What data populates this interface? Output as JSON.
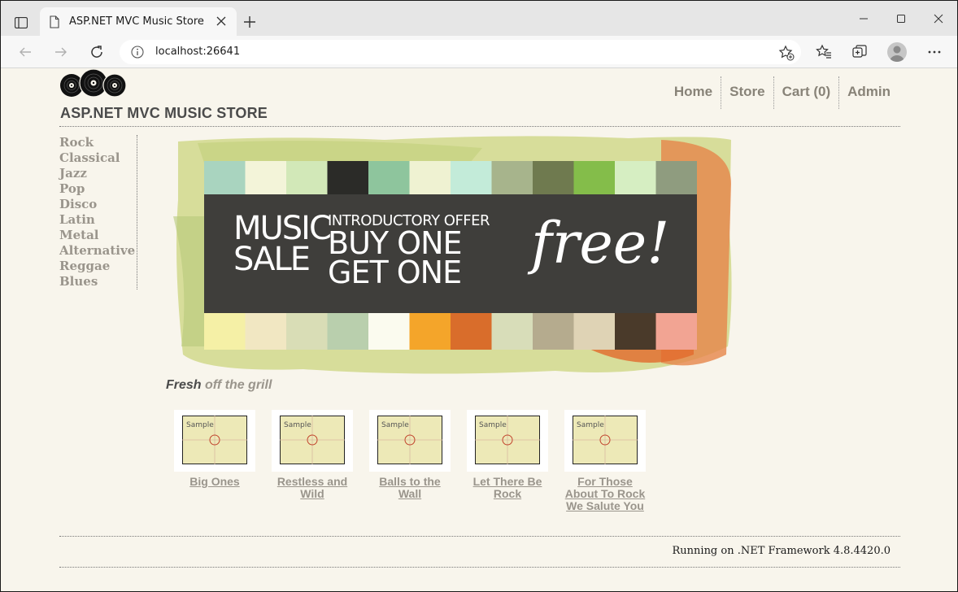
{
  "browser": {
    "tab_title": "ASP.NET MVC Music Store",
    "url": "localhost:26641",
    "icons": [
      "tab-actions-icon",
      "page-icon",
      "close-icon",
      "plus-icon",
      "minimize-icon",
      "maximize-icon",
      "close-window-icon",
      "back-icon",
      "forward-icon",
      "refresh-icon",
      "info-icon",
      "add-favorite-icon",
      "favorites-icon",
      "collections-icon",
      "profile-icon",
      "more-icon"
    ]
  },
  "site": {
    "title": "ASP.NET MVC MUSIC STORE",
    "nav": [
      "Home",
      "Store",
      "Cart (0)",
      "Admin"
    ]
  },
  "genres": [
    "Rock",
    "Classical",
    "Jazz",
    "Pop",
    "Disco",
    "Latin",
    "Metal",
    "Alternative",
    "Reggae",
    "Blues"
  ],
  "banner": {
    "left_line1": "MUSIC",
    "left_line2": "SALE",
    "offer_label": "INTRODUCTORY OFFER",
    "line1": "BUY ONE",
    "line2": "GET ONE",
    "script": "free!"
  },
  "fresh": {
    "lead": "Fresh",
    "rest": " off the grill"
  },
  "albums": [
    {
      "sample": "Sample",
      "title": "Big Ones"
    },
    {
      "sample": "Sample",
      "title": "Restless and Wild"
    },
    {
      "sample": "Sample",
      "title": "Balls to the Wall"
    },
    {
      "sample": "Sample",
      "title": "Let There Be Rock"
    },
    {
      "sample": "Sample",
      "title": "For Those About To Rock We Salute You"
    }
  ],
  "footer": "Running on .NET Framework 4.8.4420.0"
}
